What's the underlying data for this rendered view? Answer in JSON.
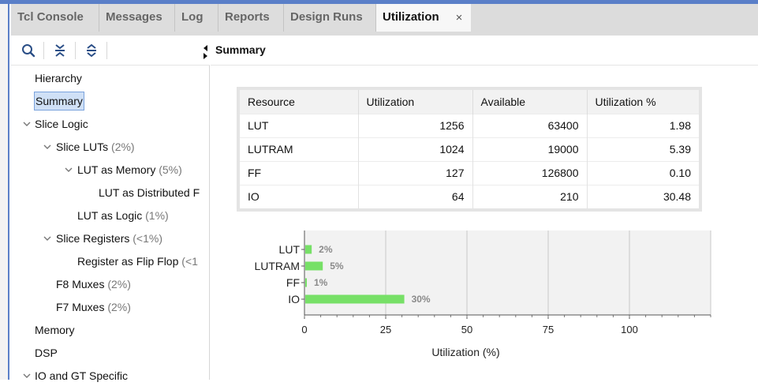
{
  "tabs": [
    {
      "label": "Tcl Console",
      "active": false
    },
    {
      "label": "Messages",
      "active": false
    },
    {
      "label": "Log",
      "active": false
    },
    {
      "label": "Reports",
      "active": false
    },
    {
      "label": "Design Runs",
      "active": false
    },
    {
      "label": "Utilization",
      "active": true
    }
  ],
  "tab_close": "×",
  "toolbar_icons": [
    "search-icon",
    "collapse-all-icon",
    "expand-all-icon"
  ],
  "tree": [
    {
      "label": "Hierarchy",
      "pct": "",
      "expanded": null,
      "selected": false
    },
    {
      "label": "Summary",
      "pct": "",
      "expanded": null,
      "selected": true
    },
    {
      "label": "Slice Logic",
      "pct": "",
      "expanded": true,
      "selected": false
    },
    {
      "label": "Slice LUTs",
      "pct": "(2%)",
      "expanded": true,
      "selected": false
    },
    {
      "label": "LUT as Memory",
      "pct": "(5%)",
      "expanded": true,
      "selected": false
    },
    {
      "label": "LUT as Distributed F",
      "pct": "",
      "expanded": null,
      "selected": false
    },
    {
      "label": "LUT as Logic",
      "pct": "(1%)",
      "expanded": null,
      "selected": false
    },
    {
      "label": "Slice Registers",
      "pct": "(<1%)",
      "expanded": true,
      "selected": false
    },
    {
      "label": "Register as Flip Flop",
      "pct": "(<1",
      "expanded": null,
      "selected": false
    },
    {
      "label": "F8 Muxes",
      "pct": "(2%)",
      "expanded": null,
      "selected": false
    },
    {
      "label": "F7 Muxes",
      "pct": "(2%)",
      "expanded": null,
      "selected": false
    },
    {
      "label": "Memory",
      "pct": "",
      "expanded": null,
      "selected": false
    },
    {
      "label": "DSP",
      "pct": "",
      "expanded": null,
      "selected": false
    },
    {
      "label": "IO and GT Specific",
      "pct": "",
      "expanded": true,
      "selected": false
    }
  ],
  "summary_title": "Summary",
  "table": {
    "headers": [
      "Resource",
      "Utilization",
      "Available",
      "Utilization %"
    ],
    "rows": [
      [
        "LUT",
        "1256",
        "63400",
        "1.98"
      ],
      [
        "LUTRAM",
        "1024",
        "19000",
        "5.39"
      ],
      [
        "FF",
        "127",
        "126800",
        "0.10"
      ],
      [
        "IO",
        "64",
        "210",
        "30.48"
      ]
    ]
  },
  "chart_data": {
    "type": "bar",
    "orientation": "horizontal",
    "categories": [
      "LUT",
      "LUTRAM",
      "FF",
      "IO"
    ],
    "values": [
      1.98,
      5.39,
      0.1,
      30.48
    ],
    "data_labels": [
      "2%",
      "5%",
      "1%",
      "30%"
    ],
    "xlabel": "Utilization (%)",
    "xticks": [
      "0",
      "25",
      "50",
      "75",
      "100"
    ],
    "xlim": [
      0,
      125
    ],
    "grid": true,
    "bar_color": "#77e067"
  },
  "colors": {
    "accent": "#5a7fc8",
    "selection": "#cfe0f6",
    "bar": "#77e067"
  }
}
